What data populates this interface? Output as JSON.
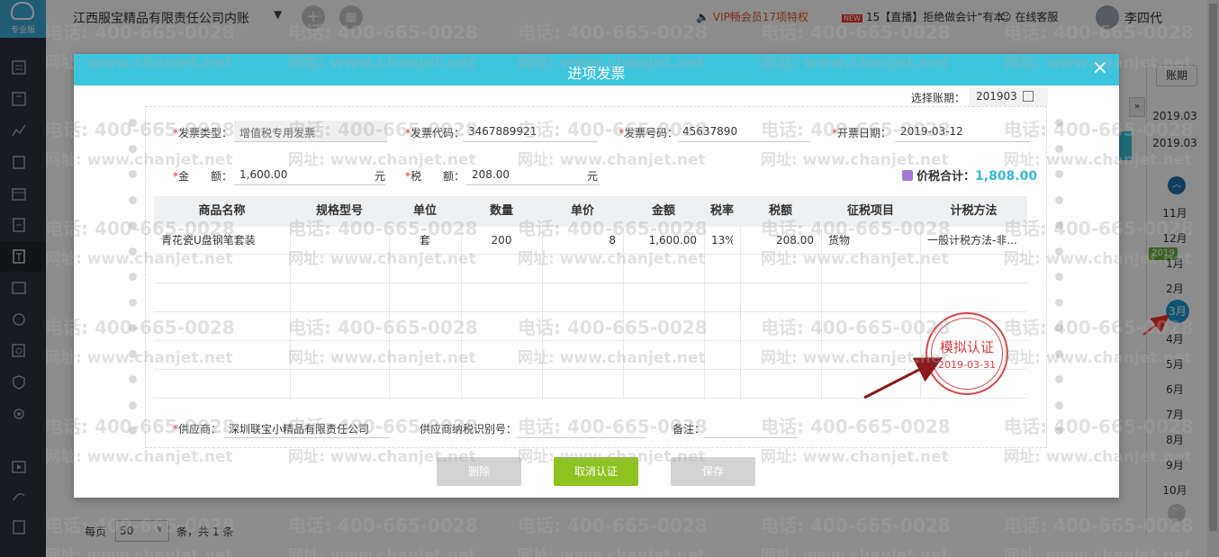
{
  "app": {
    "company": "江西服宝精品有限责任公司内账",
    "logo_text": "专业版",
    "vip": "VIP畅会员17项特权",
    "live_badge": "NEW",
    "live": "15【直播】拒绝做会计“有本",
    "service": "在线客服",
    "user": "李四代"
  },
  "right_panel": {
    "period_label": "账期",
    "dates": [
      "2019.03",
      "2019.03"
    ],
    "months_before": [
      "11月",
      "12月"
    ],
    "year_badge": "2019",
    "months_after": [
      "1月",
      "2月"
    ],
    "current_month": "3月",
    "months_rest": [
      "4月",
      "5月",
      "6月",
      "7月",
      "8月",
      "9月",
      "10月"
    ]
  },
  "pager": {
    "per_page_label": "每页",
    "per_page_value": "50",
    "count_label": "条，共 1 条"
  },
  "watermark": {
    "phone": "电话: 400-665-0028",
    "site": "网址: www.chanjet.net"
  },
  "modal": {
    "title": "进项发票",
    "close": "×",
    "period_label": "选择账期：",
    "period_value": "201903",
    "fields": {
      "invoice_type_label": "发票类型：",
      "invoice_type_value": "增值税专用发票",
      "invoice_code_label": "发票代码：",
      "invoice_code_value": "3467889921",
      "invoice_no_label": "发票号码：",
      "invoice_no_value": "45637890",
      "issue_date_label": "开票日期：",
      "issue_date_value": "2019-03-12",
      "amount_label": "金　　额：",
      "amount_value": "1,600.00",
      "amount_unit": "元",
      "tax_label": "税　　额：",
      "tax_value": "208.00",
      "tax_unit": "元"
    },
    "total_label": "价税合计：",
    "total_value": "1,808.00",
    "columns": [
      "商品名称",
      "规格型号",
      "单位",
      "数量",
      "单价",
      "金额",
      "税率",
      "税额",
      "征税项目",
      "计税方法"
    ],
    "rows": [
      {
        "name": "青花瓷U盘钢笔套装",
        "spec": "",
        "unit": "套",
        "qty": "200",
        "price": "8",
        "amount": "1,600.00",
        "rate": "13%",
        "tax": "208.00",
        "item": "货物",
        "method": "一般计税方法-非..."
      }
    ],
    "supplier_label": "供应商：",
    "supplier_value": "深圳联宝小精品有限责任公司",
    "supplier_tax_label": "供应商纳税识别号：",
    "supplier_tax_value": "",
    "remark_label": "备注：",
    "remark_value": "",
    "stamp_title": "模拟认证",
    "stamp_date": "2019-03-31",
    "buttons": {
      "delete": "删除",
      "cancel_auth": "取消认证",
      "save": "保存"
    }
  },
  "colors": {
    "header": "#3ec5de",
    "primary_button": "#8dc21f",
    "disabled_button": "#d3d3d3",
    "stamp": "#d94545",
    "total": "#3ab8d6"
  }
}
